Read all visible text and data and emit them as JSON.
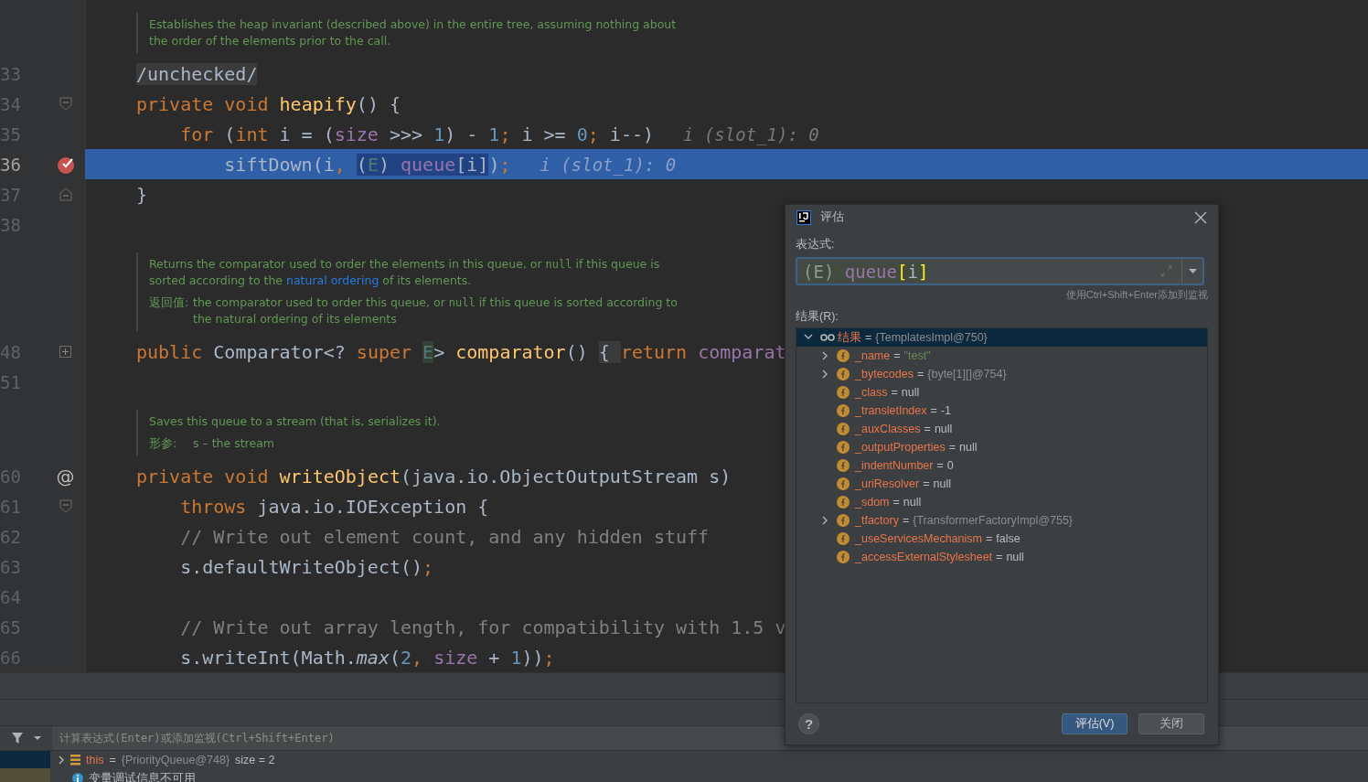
{
  "editor": {
    "items": [
      {
        "kind": "doc",
        "paragraphs": [
          {
            "segments": [
              {
                "text": "Establishes the heap invariant (described above) in the entire tree, assuming nothing about the order of the elements prior to the call.",
                "kind": "text"
              }
            ]
          }
        ]
      },
      {
        "kind": "line",
        "number": "33",
        "highlighted": false,
        "tokens": [
          {
            "text": "/unchecked/",
            "kind": "folded"
          }
        ]
      },
      {
        "kind": "line",
        "number": "34",
        "gutter_icon": {
          "kind": "fold-start"
        },
        "highlighted": false,
        "tokens": [
          {
            "text": "private void ",
            "kind": "keyword"
          },
          {
            "text": "heapify",
            "kind": "method"
          },
          {
            "text": "() {",
            "kind": "plain"
          }
        ]
      },
      {
        "kind": "line",
        "number": "35",
        "highlighted": false,
        "hint": "i (slot_1): 0",
        "tokens": [
          {
            "text": "    for ",
            "kind": "keyword"
          },
          {
            "text": "(",
            "kind": "plain"
          },
          {
            "text": "int",
            "kind": "keyword"
          },
          {
            "text": " i = (",
            "kind": "plain"
          },
          {
            "text": "size",
            "kind": "field"
          },
          {
            "text": " >>> ",
            "kind": "plain"
          },
          {
            "text": "1",
            "kind": "number"
          },
          {
            "text": ") - ",
            "kind": "plain"
          },
          {
            "text": "1",
            "kind": "number"
          },
          {
            "text": "; ",
            "kind": "keyword"
          },
          {
            "text": "i >= ",
            "kind": "plain"
          },
          {
            "text": "0",
            "kind": "number"
          },
          {
            "text": "; ",
            "kind": "keyword"
          },
          {
            "text": "i--)",
            "kind": "plain"
          }
        ]
      },
      {
        "kind": "line",
        "number": "36",
        "gutter_icon": {
          "kind": "breakpoint"
        },
        "highlighted": true,
        "hint": "i (slot_1): 0",
        "tokens": [
          {
            "text": "        siftDown(i",
            "kind": "plain",
            "selected": false
          },
          {
            "text": ", ",
            "kind": "keyword",
            "selected": false
          },
          {
            "text": "(",
            "kind": "plain",
            "selected": true
          },
          {
            "text": "E",
            "kind": "typeparam",
            "selected": true
          },
          {
            "text": ") ",
            "kind": "plain",
            "selected": true
          },
          {
            "text": "queue",
            "kind": "field",
            "selected": true
          },
          {
            "text": "[i]",
            "kind": "plain",
            "selected": true
          },
          {
            "text": ")",
            "kind": "plain",
            "selected": false
          },
          {
            "text": ";",
            "kind": "keyword",
            "selected": false
          }
        ]
      },
      {
        "kind": "line",
        "number": "37",
        "gutter_icon": {
          "kind": "fold-end"
        },
        "highlighted": false,
        "tokens": [
          {
            "text": "}",
            "kind": "plain"
          }
        ]
      },
      {
        "kind": "line",
        "number": "38",
        "highlighted": false
      },
      {
        "kind": "doc",
        "paragraphs": [
          {
            "segments": [
              {
                "text": "Returns the comparator used to order the elements in this queue, or ",
                "kind": "text"
              },
              {
                "text": "null",
                "kind": "code"
              },
              {
                "text": " if this queue is sorted according to the ",
                "kind": "text"
              },
              {
                "text": "natural ordering",
                "kind": "link"
              },
              {
                "text": " of its elements.",
                "kind": "text"
              }
            ]
          },
          {
            "label": "返回值:",
            "segments": [
              {
                "text": "the comparator used to order this queue, or ",
                "kind": "text"
              },
              {
                "text": "null",
                "kind": "code"
              },
              {
                "text": " if this queue is sorted according to the natural ordering of its elements",
                "kind": "text"
              }
            ]
          }
        ]
      },
      {
        "kind": "line",
        "number": "48",
        "gutter_icon": {
          "kind": "fold-collapsed"
        },
        "highlighted": false,
        "tokens": [
          {
            "text": "public ",
            "kind": "keyword"
          },
          {
            "text": "Comparator<? ",
            "kind": "plain"
          },
          {
            "text": "super ",
            "kind": "keyword"
          },
          {
            "text": "E",
            "kind": "typeparam-marked"
          },
          {
            "text": "> ",
            "kind": "plain"
          },
          {
            "text": "comparator",
            "kind": "method"
          },
          {
            "text": "() ",
            "kind": "plain"
          },
          {
            "text": "{ ",
            "kind": "folded"
          },
          {
            "text": "return ",
            "kind": "keyword"
          },
          {
            "text": "comparat",
            "kind": "field"
          }
        ]
      },
      {
        "kind": "line",
        "number": "51",
        "highlighted": false
      },
      {
        "kind": "doc",
        "paragraphs": [
          {
            "segments": [
              {
                "text": "Saves this queue to a stream (that is, serializes it).",
                "kind": "text"
              }
            ]
          },
          {
            "label": "形参:",
            "segments": [
              {
                "text": "s – the stream",
                "kind": "text"
              }
            ]
          }
        ]
      },
      {
        "kind": "line",
        "number": "60",
        "gutter_icon": {
          "kind": "mark",
          "text": "@"
        },
        "highlighted": false,
        "tokens": [
          {
            "text": "private void ",
            "kind": "keyword"
          },
          {
            "text": "writeObject",
            "kind": "method"
          },
          {
            "text": "(java.io.ObjectOutputStream s)",
            "kind": "plain"
          }
        ]
      },
      {
        "kind": "line",
        "number": "61",
        "gutter_icon": {
          "kind": "fold-start"
        },
        "highlighted": false,
        "tokens": [
          {
            "text": "    throws ",
            "kind": "keyword"
          },
          {
            "text": "java.io.IOException {",
            "kind": "plain"
          }
        ]
      },
      {
        "kind": "line",
        "number": "62",
        "highlighted": false,
        "tokens": [
          {
            "text": "    // Write out element count, and any hidden stuff",
            "kind": "comment"
          }
        ]
      },
      {
        "kind": "line",
        "number": "63",
        "highlighted": false,
        "tokens": [
          {
            "text": "    s.defaultWriteObject()",
            "kind": "plain"
          },
          {
            "text": ";",
            "kind": "keyword"
          }
        ]
      },
      {
        "kind": "line",
        "number": "64",
        "highlighted": false
      },
      {
        "kind": "line",
        "number": "65",
        "highlighted": false,
        "tokens": [
          {
            "text": "    // Write out array length, for compatibility with 1.5 v",
            "kind": "comment"
          }
        ]
      },
      {
        "kind": "line",
        "number": "66",
        "highlighted": false,
        "tokens": [
          {
            "text": "    s.writeInt(Math.",
            "kind": "plain"
          },
          {
            "text": "max",
            "kind": "static"
          },
          {
            "text": "(",
            "kind": "plain"
          },
          {
            "text": "2",
            "kind": "number"
          },
          {
            "text": ", ",
            "kind": "keyword"
          },
          {
            "text": "size",
            "kind": "field"
          },
          {
            "text": " + ",
            "kind": "plain"
          },
          {
            "text": "1",
            "kind": "number"
          },
          {
            "text": "))",
            "kind": "plain"
          },
          {
            "text": ";",
            "kind": "keyword"
          }
        ]
      }
    ]
  },
  "debugger": {
    "watch_placeholder": "计算表达式(Enter)或添加监视(Ctrl+Shift+Enter)",
    "variables": [
      {
        "kind": "object",
        "expandable": true,
        "name": "this",
        "eq": "=",
        "value": "{PriorityQueue@748}",
        "extra": "size = 2"
      },
      {
        "kind": "info",
        "text": "变量调试信息不可用"
      }
    ]
  },
  "dialog": {
    "title": "评估",
    "expression_label": "表达式:",
    "expression": [
      {
        "text": "(E) ",
        "kind": "cast"
      },
      {
        "text": "queue",
        "kind": "field"
      },
      {
        "text": "[",
        "kind": "bracket"
      },
      {
        "text": "i",
        "kind": "plain"
      },
      {
        "text": "]",
        "kind": "bracket"
      }
    ],
    "hint": "使用Ctrl+Shift+Enter添加到监视",
    "result_label": "结果(R):",
    "result": {
      "name": "结果",
      "eq": "=",
      "value": "{TemplatesImpl@750}",
      "expanded": true,
      "selected": true,
      "children": [
        {
          "name": "_name",
          "eq": "=",
          "value": "\"test\"",
          "kind": "string",
          "expandable": true,
          "selected": false
        },
        {
          "name": "_bytecodes",
          "eq": "=",
          "value": "{byte[1][]@754}",
          "kind": "object",
          "expandable": true,
          "selected": false
        },
        {
          "name": "_class",
          "eq": "=",
          "value": "null",
          "kind": "plain",
          "expandable": false,
          "selected": false
        },
        {
          "name": "_transletIndex",
          "eq": "=",
          "value": "-1",
          "kind": "plain",
          "expandable": false,
          "selected": false
        },
        {
          "name": "_auxClasses",
          "eq": "=",
          "value": "null",
          "kind": "plain",
          "expandable": false,
          "selected": false
        },
        {
          "name": "_outputProperties",
          "eq": "=",
          "value": "null",
          "kind": "plain",
          "expandable": false,
          "selected": false
        },
        {
          "name": "_indentNumber",
          "eq": "=",
          "value": "0",
          "kind": "plain",
          "expandable": false,
          "selected": false
        },
        {
          "name": "_uriResolver",
          "eq": "=",
          "value": "null",
          "kind": "plain",
          "expandable": false,
          "selected": false
        },
        {
          "name": "_sdom",
          "eq": "=",
          "value": "null",
          "kind": "plain",
          "expandable": false,
          "selected": false
        },
        {
          "name": "_tfactory",
          "eq": "=",
          "value": "{TransformerFactoryImpl@755}",
          "kind": "object",
          "expandable": true,
          "selected": false
        },
        {
          "name": "_useServicesMechanism",
          "eq": "=",
          "value": "false",
          "kind": "plain",
          "expandable": false,
          "selected": false
        },
        {
          "name": "_accessExternalStylesheet",
          "eq": "=",
          "value": "null",
          "kind": "plain",
          "expandable": false,
          "selected": false
        }
      ]
    },
    "help": "?",
    "buttons": [
      {
        "label": "评估(V)",
        "primary": true
      },
      {
        "label": "关闭",
        "primary": false
      }
    ]
  }
}
